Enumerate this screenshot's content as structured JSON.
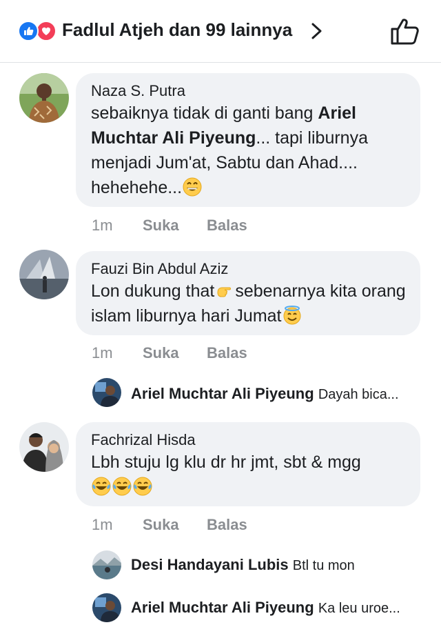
{
  "header": {
    "reactors_text": "Fadlul Atjeh dan 99 lainnya"
  },
  "comments": [
    {
      "author": "Naza S. Putra",
      "text_before": "sebaiknya tidak di ganti bang ",
      "mention": "Ariel Muchtar Ali Piyeung",
      "text_after": "... tapi liburnya menjadi Jum'at, Sabtu dan Ahad.... hehehehe...",
      "time": "1m",
      "like_label": "Suka",
      "reply_label": "Balas"
    },
    {
      "author": "Fauzi Bin Abdul Aziz",
      "text_part1": "Lon dukung that",
      "text_part2": "sebenarnya kita orang islam liburnya hari Jumat",
      "time": "1m",
      "like_label": "Suka",
      "reply_label": "Balas",
      "replies": [
        {
          "name": "Ariel Muchtar Ali Piyeung",
          "text": "Dayah bica..."
        }
      ]
    },
    {
      "author": "Fachrizal Hisda",
      "text": "Lbh stuju lg klu dr hr jmt, sbt & mgg",
      "time": "1m",
      "like_label": "Suka",
      "reply_label": "Balas",
      "replies": [
        {
          "name": "Desi Handayani Lubis",
          "text": "Btl tu mon"
        },
        {
          "name": "Ariel Muchtar Ali Piyeung",
          "text": "Ka leu uroe..."
        }
      ]
    }
  ],
  "colors": {
    "like_blue": "#1877f2",
    "love_red": "#f33e58",
    "bubble_bg": "#f0f2f5",
    "meta_gray": "#8a8d91"
  },
  "icons": [
    "like-reaction-icon",
    "love-reaction-icon",
    "chevron-right-icon",
    "thumbs-up-icon",
    "grin-emoji-icon",
    "pointing-hand-emoji-icon",
    "halo-emoji-icon",
    "laugh-tears-emoji-icon"
  ]
}
